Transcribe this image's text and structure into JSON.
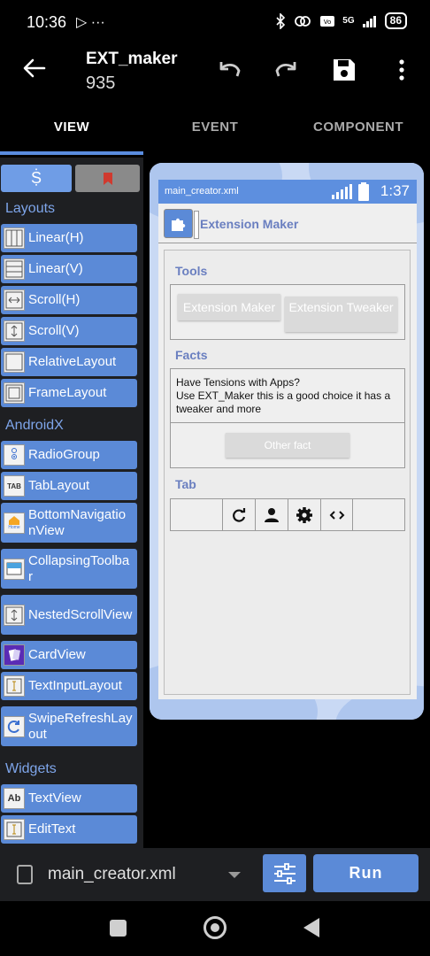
{
  "status_bar": {
    "time": "10:36",
    "left_icons": "▷ ···",
    "battery": "86",
    "network": "5G"
  },
  "app_bar": {
    "title": "EXT_maker",
    "subtitle": "935",
    "icons": [
      "back-arrow-icon",
      "undo-icon",
      "redo-icon",
      "save-icon",
      "more-vert-icon"
    ]
  },
  "tabs": [
    {
      "label": "VIEW",
      "active": true
    },
    {
      "label": "EVENT",
      "active": false
    },
    {
      "label": "COMPONENT",
      "active": false
    }
  ],
  "palette": {
    "tab1_icon": "Ṩ",
    "sections": [
      {
        "title": "Layouts",
        "items": [
          "Linear(H)",
          "Linear(V)",
          "Scroll(H)",
          "Scroll(V)",
          "RelativeLayout",
          "FrameLayout"
        ]
      },
      {
        "title": "AndroidX",
        "items": [
          "RadioGroup",
          "TabLayout",
          "BottomNavigationView",
          "CollapsingToolbar",
          "NestedScrollView",
          "CardView",
          "TextInputLayout",
          "SwipeRefreshLayout"
        ]
      },
      {
        "title": "Widgets",
        "items": [
          "TextView",
          "EditText"
        ]
      }
    ],
    "icon_text": {
      "tab": "TAB",
      "text": "Ab",
      "home": "Home"
    }
  },
  "preview": {
    "file_name": "main_creator.xml",
    "clock": "1:37",
    "app_title": "Extension Maker",
    "tools_label": "Tools",
    "tool_button_1": "Extension Maker",
    "tool_button_2": "Extension Tweaker",
    "facts_label": "Facts",
    "fact_line_1": "Have Tensions with Apps?",
    "fact_line_2": "Use EXT_Maker this is a good choice it has a tweaker and more",
    "other_fact_button": "Other fact",
    "tab_label": "Tab",
    "tab_icons": [
      "refresh-icon",
      "person-icon",
      "gear-icon",
      "code-icon"
    ]
  },
  "bottom_bar": {
    "file_name": "main_creator.xml",
    "run_label": "Run"
  },
  "colors": {
    "accent": "#5b8ad7",
    "section_text": "#7ea5ea",
    "preview_title": "#6a7fc0"
  }
}
